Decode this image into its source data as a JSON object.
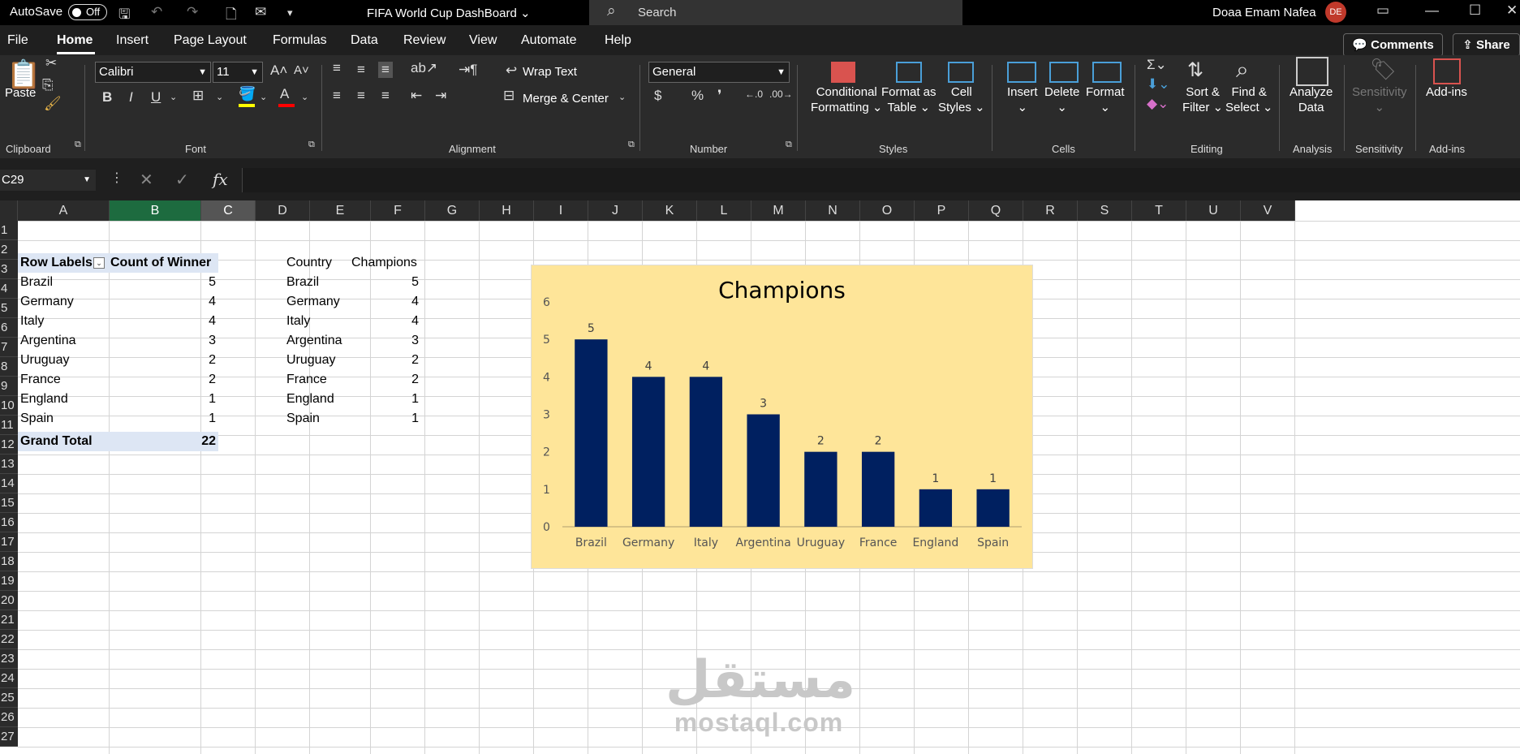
{
  "titlebar": {
    "autosave_label": "AutoSave",
    "autosave_state": "Off",
    "doc_title": "FIFA World Cup DashBoard ⌄",
    "search_placeholder": "Search",
    "user_name": "Doaa Emam Nafea",
    "user_initials": "DE"
  },
  "menu": {
    "items": [
      "File",
      "Home",
      "Insert",
      "Page Layout",
      "Formulas",
      "Data",
      "Review",
      "View",
      "Automate",
      "Help"
    ],
    "comments": "Comments",
    "share": "Share"
  },
  "ribbon": {
    "clipboard": {
      "paste": "Paste",
      "label": "Clipboard"
    },
    "font": {
      "name": "Calibri",
      "size": "11",
      "label": "Font",
      "bold": "B",
      "italic": "I",
      "underline": "U"
    },
    "alignment": {
      "wrap": "Wrap Text",
      "merge": "Merge & Center",
      "label": "Alignment"
    },
    "number": {
      "format": "General",
      "label": "Number",
      "currency": "$",
      "percent": "%",
      "comma": "❜"
    },
    "styles": {
      "conditional_1": "Conditional",
      "conditional_2": "Formatting ⌄",
      "format_table_1": "Format as",
      "format_table_2": "Table ⌄",
      "cell_styles_1": "Cell",
      "cell_styles_2": "Styles ⌄",
      "label": "Styles"
    },
    "cells": {
      "insert": "Insert",
      "delete": "Delete",
      "format": "Format",
      "label": "Cells"
    },
    "editing": {
      "sort_1": "Sort &",
      "sort_2": "Filter ⌄",
      "find_1": "Find &",
      "find_2": "Select ⌄",
      "label": "Editing"
    },
    "analysis": {
      "analyze_1": "Analyze",
      "analyze_2": "Data",
      "label": "Analysis"
    },
    "sensitivity": {
      "btn": "Sensitivity",
      "label": "Sensitivity"
    },
    "addins": {
      "btn": "Add-ins",
      "label": "Add-ins"
    }
  },
  "formula_bar": {
    "name_box": "C29",
    "fx": "fx",
    "formula": ""
  },
  "columns": [
    "A",
    "B",
    "C",
    "D",
    "E",
    "F",
    "G",
    "H",
    "I",
    "J",
    "K",
    "L",
    "M",
    "N",
    "O",
    "P",
    "Q",
    "R",
    "S",
    "T",
    "U",
    "V"
  ],
  "rows": [
    "1",
    "2",
    "3",
    "4",
    "5",
    "6",
    "7",
    "8",
    "9",
    "10",
    "11",
    "12",
    "13",
    "14",
    "15",
    "16",
    "17",
    "18",
    "19",
    "20",
    "21",
    "22",
    "23",
    "24",
    "25",
    "26",
    "27"
  ],
  "pivot": {
    "header_labels": "Row Labels",
    "header_count": "Count of Winner",
    "rows": [
      {
        "country": "Brazil",
        "count": "5"
      },
      {
        "country": "Germany",
        "count": "4"
      },
      {
        "country": "Italy",
        "count": "4"
      },
      {
        "country": "Argentina",
        "count": "3"
      },
      {
        "country": "Uruguay",
        "count": "2"
      },
      {
        "country": "France",
        "count": "2"
      },
      {
        "country": "England",
        "count": "1"
      },
      {
        "country": "Spain",
        "count": "1"
      }
    ],
    "total_label": "Grand Total",
    "total_value": "22"
  },
  "table": {
    "header_country": "Country",
    "header_champions": "Champions",
    "rows": [
      {
        "country": "Brazil",
        "champions": "5"
      },
      {
        "country": "Germany",
        "champions": "4"
      },
      {
        "country": "Italy",
        "champions": "4"
      },
      {
        "country": "Argentina",
        "champions": "3"
      },
      {
        "country": "Uruguay",
        "champions": "2"
      },
      {
        "country": "France",
        "champions": "2"
      },
      {
        "country": "England",
        "champions": "1"
      },
      {
        "country": "Spain",
        "champions": "1"
      }
    ]
  },
  "chart_data": {
    "type": "bar",
    "title": "Champions",
    "categories": [
      "Brazil",
      "Germany",
      "Italy",
      "Argentina",
      "Uruguay",
      "France",
      "England",
      "Spain"
    ],
    "values": [
      5,
      4,
      4,
      3,
      2,
      2,
      1,
      1
    ],
    "ylim": [
      0,
      6
    ],
    "yticks": [
      0,
      1,
      2,
      3,
      4,
      5,
      6
    ],
    "xlabel": "",
    "ylabel": "",
    "grid": false,
    "data_labels": true,
    "bar_color": "#002060",
    "background": "#fee599"
  },
  "watermark": {
    "arabic": "مستقل",
    "latin": "mostaql.com"
  }
}
